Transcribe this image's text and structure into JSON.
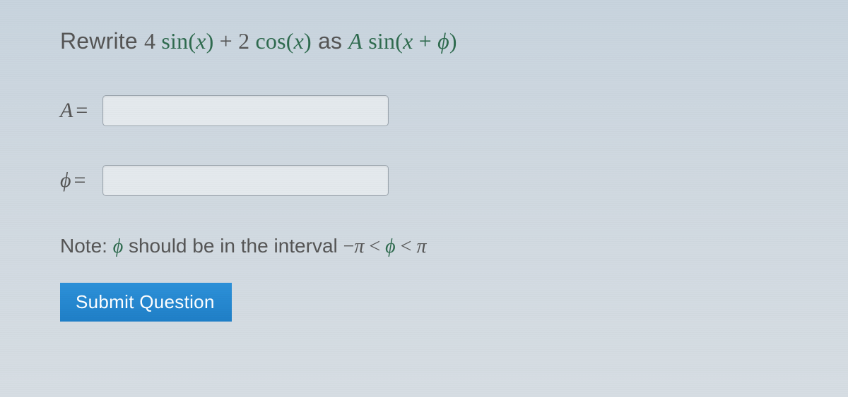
{
  "prompt": {
    "intro": "Rewrite ",
    "expr_lhs_coef1": "4",
    "expr_lhs_func1": "sin",
    "expr_lhs_arg1": "x",
    "expr_lhs_plus": " + ",
    "expr_lhs_coef2": "2",
    "expr_lhs_func2": "cos",
    "expr_lhs_arg2": "x",
    "mid": " as ",
    "rhs_A": "A",
    "rhs_func": "sin",
    "rhs_arg_x": "x",
    "rhs_plus": " + ",
    "rhs_phi": "ϕ"
  },
  "labels": {
    "A": "A",
    "phi": "ϕ",
    "eq": "="
  },
  "inputs": {
    "A_value": "",
    "phi_value": ""
  },
  "note": {
    "pre": "Note: ",
    "phi": "ϕ",
    "mid": " should be in the interval ",
    "neg": "−",
    "pi1": "π",
    "lt1": " < ",
    "phi2": "ϕ",
    "lt2": " < ",
    "pi2": "π"
  },
  "button": {
    "submit": "Submit Question"
  },
  "colors": {
    "accent": "#2484cf",
    "link_green": "#2f6b4f"
  },
  "chart_data": {
    "type": "table",
    "description": "Form for rewriting a sinusoidal sum in amplitude-phase form",
    "expression_input": "4 sin(x) + 2 cos(x)",
    "target_form": "A sin(x + ϕ)",
    "fields": [
      {
        "name": "A",
        "value": null
      },
      {
        "name": "ϕ",
        "value": null,
        "constraint": "−π < ϕ < π"
      }
    ]
  }
}
